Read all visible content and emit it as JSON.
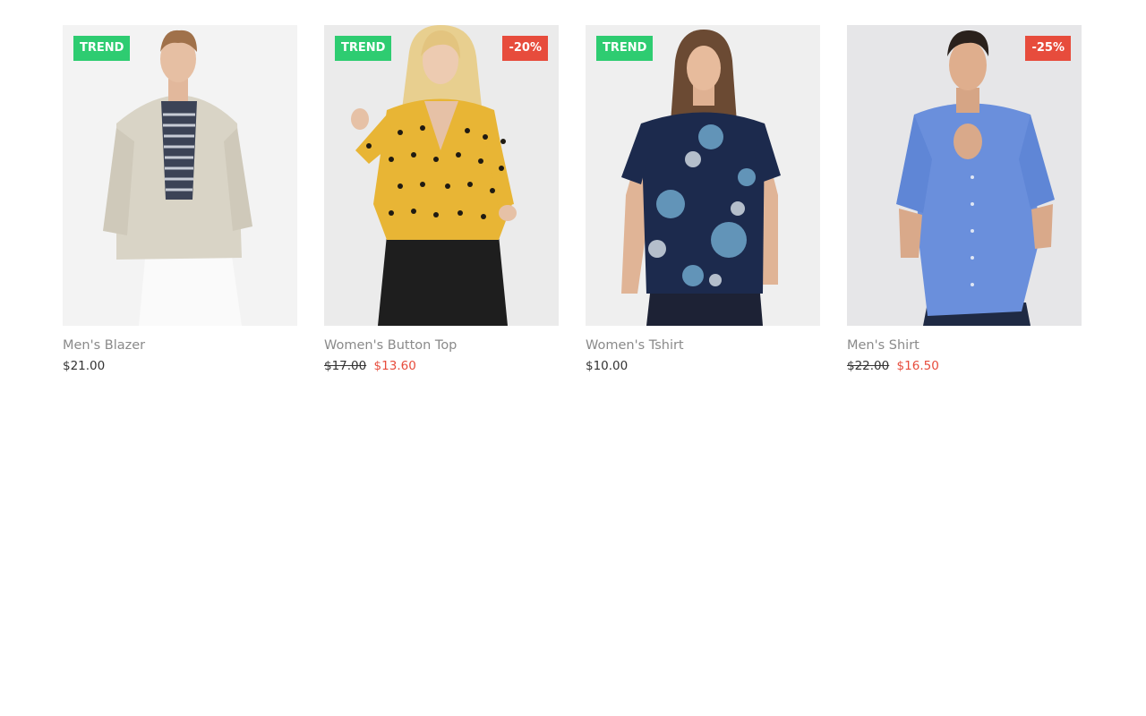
{
  "colors": {
    "trend_badge": "#2ecc71",
    "discount_badge": "#e74c3c",
    "sale_price": "#e74c3c",
    "product_name": "#8a8a8a",
    "price": "#333333"
  },
  "products": [
    {
      "name": "Men's Blazer",
      "image": "man-in-linen-blazer-photo",
      "trend_badge": "TREND",
      "discount_badge": "",
      "price": "$21.00",
      "old_price": "",
      "sale_price": ""
    },
    {
      "name": "Women's Button Top",
      "image": "woman-in-yellow-polka-dot-top-photo",
      "trend_badge": "TREND",
      "discount_badge": "-20%",
      "price": "",
      "old_price": "$17.00",
      "sale_price": "$13.60"
    },
    {
      "name": "Women's Tshirt",
      "image": "woman-in-navy-floral-tshirt-photo",
      "trend_badge": "TREND",
      "discount_badge": "",
      "price": "$10.00",
      "old_price": "",
      "sale_price": ""
    },
    {
      "name": "Men's Shirt",
      "image": "man-in-blue-shirt-photo",
      "trend_badge": "",
      "discount_badge": "-25%",
      "price": "",
      "old_price": "$22.00",
      "sale_price": "$16.50"
    }
  ]
}
